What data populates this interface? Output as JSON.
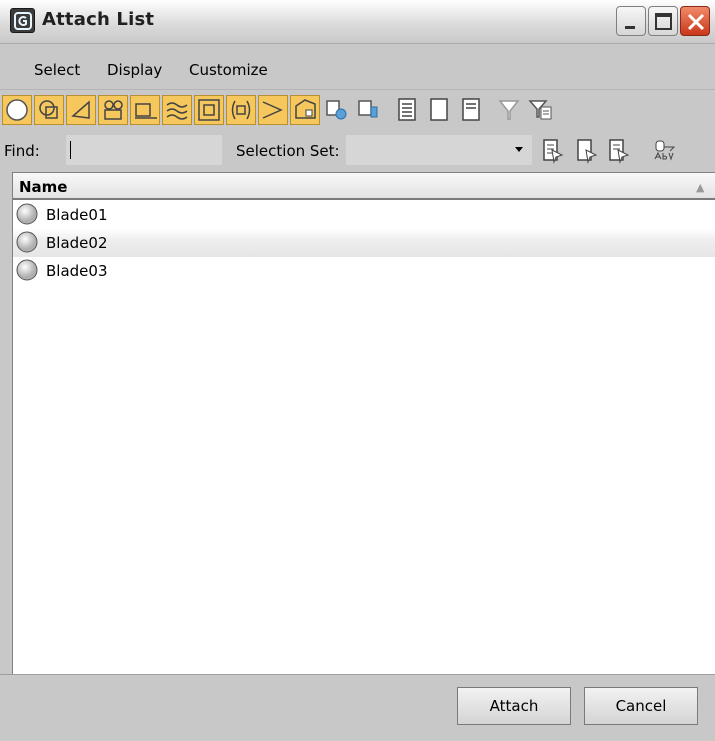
{
  "window": {
    "title": "Attach List",
    "controls": {
      "minimize": "minimize",
      "maximize": "maximize",
      "close": "close"
    }
  },
  "menu": {
    "items": [
      {
        "label": "Select"
      },
      {
        "label": "Display"
      },
      {
        "label": "Customize"
      }
    ]
  },
  "toolbar": {
    "tools": [
      {
        "name": "sphere-geometry-icon",
        "active": true
      },
      {
        "name": "shapes-icon",
        "active": true
      },
      {
        "name": "light-icon",
        "active": true
      },
      {
        "name": "camera-icon",
        "active": true
      },
      {
        "name": "helper-icon",
        "active": true
      },
      {
        "name": "space-warp-icon",
        "active": true
      },
      {
        "name": "group-icon",
        "active": true
      },
      {
        "name": "object-xref-icon",
        "active": true
      },
      {
        "name": "bone-icon",
        "active": true
      },
      {
        "name": "container-icon",
        "active": true
      },
      {
        "name": "frozen-objects-icon",
        "active": false
      },
      {
        "name": "hidden-objects-icon",
        "active": false
      },
      {
        "name": "select-all-icon",
        "active": false
      },
      {
        "name": "select-none-icon",
        "active": false
      },
      {
        "name": "select-invert-icon",
        "active": false
      },
      {
        "name": "filter-icon",
        "active": false
      },
      {
        "name": "filter-settings-icon",
        "active": false
      }
    ]
  },
  "find": {
    "label": "Find:",
    "value": "",
    "selection_set_label": "Selection Set:",
    "selection_set_value": ""
  },
  "list": {
    "header": "Name",
    "rows": [
      {
        "label": "Blade01"
      },
      {
        "label": "Blade02"
      },
      {
        "label": "Blade03"
      }
    ]
  },
  "buttons": {
    "attach": "Attach",
    "cancel": "Cancel"
  },
  "colors": {
    "toolbar_active": "#f5c75c",
    "dialog_bg": "#c8c8c8",
    "close_button": "#d44a2a"
  }
}
